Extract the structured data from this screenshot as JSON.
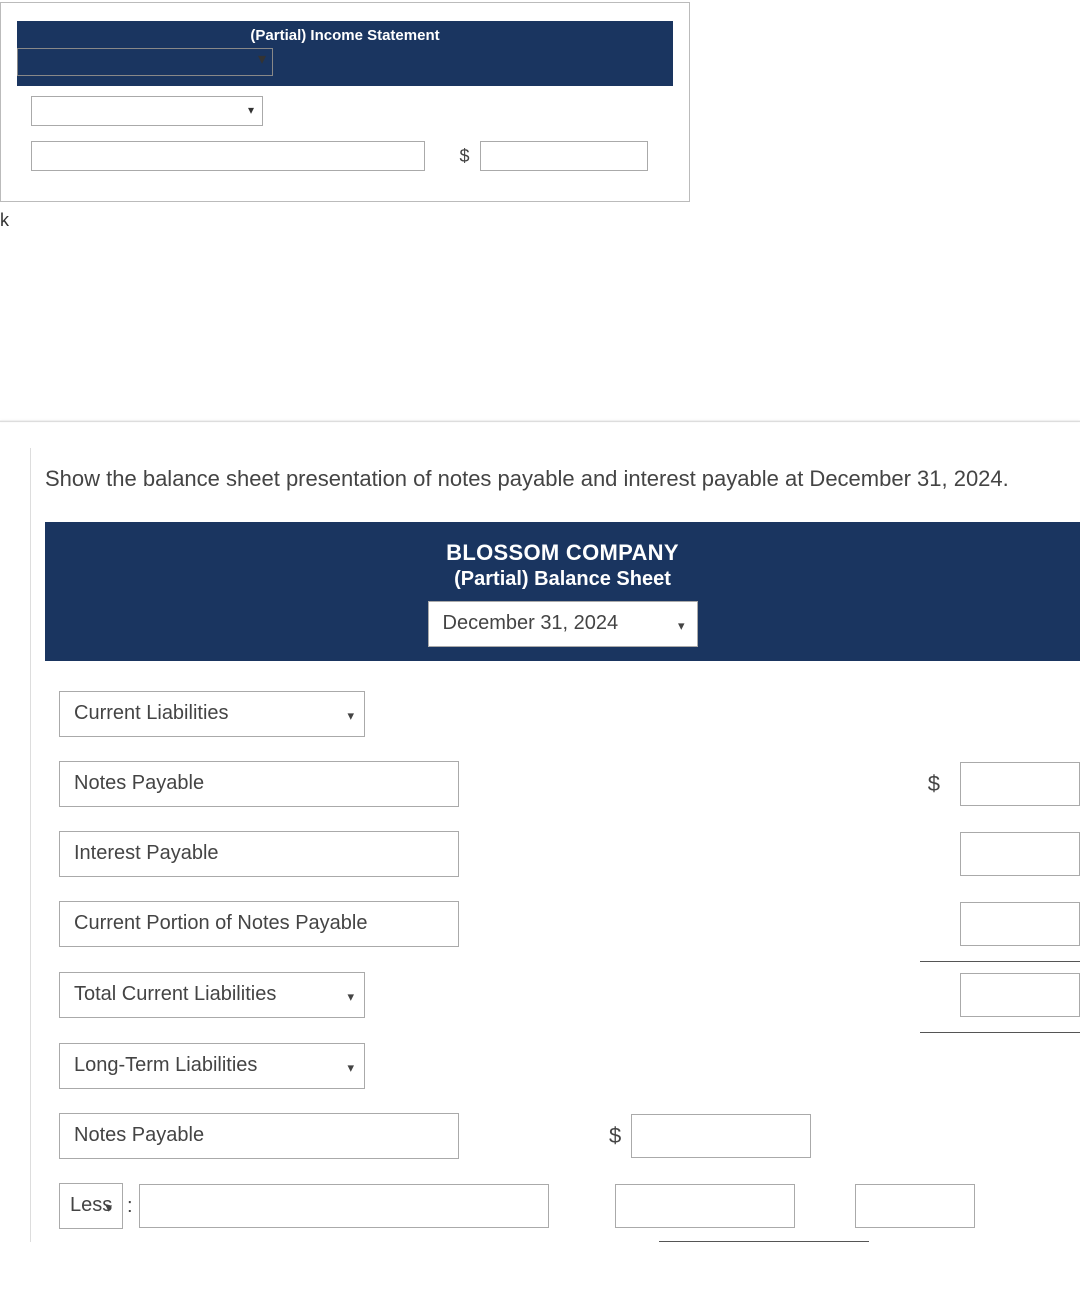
{
  "income_statement": {
    "title": "(Partial) Income Statement",
    "period_selected": "",
    "row_category_selected": "",
    "row_label": "",
    "currency": "$",
    "row_value": ""
  },
  "side_label": "k",
  "instruction": "Show the balance sheet presentation of notes payable and interest payable at December 31, 2024.",
  "balance_sheet": {
    "company": "BLOSSOM COMPANY",
    "subtitle": "(Partial) Balance Sheet",
    "date_selected": "December 31, 2024",
    "sections": [
      {
        "type": "select",
        "value": "Current Liabilities"
      },
      {
        "type": "item",
        "label": "Notes Payable",
        "currency": "$",
        "value": ""
      },
      {
        "type": "item",
        "label": "Interest Payable",
        "value": ""
      },
      {
        "type": "item",
        "label": "Current Portion of Notes Payable",
        "value": ""
      },
      {
        "type": "select_total",
        "value": "Total Current Liabilities",
        "total": ""
      },
      {
        "type": "select",
        "value": "Long-Term Liabilities"
      },
      {
        "type": "item_wdollar",
        "label": "Notes Payable",
        "currency": "$",
        "value": ""
      },
      {
        "type": "less_row",
        "less_label": "Less",
        "colon": ":",
        "desc": "",
        "value1": "",
        "value2": ""
      }
    ]
  }
}
